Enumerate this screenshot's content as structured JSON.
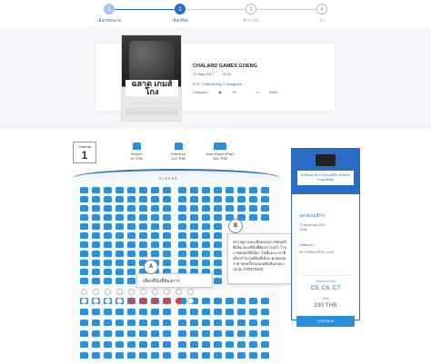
{
  "stepper": {
    "steps": [
      {
        "num": "1",
        "label": "เลือกรอบฉาย",
        "state": "done"
      },
      {
        "num": "2",
        "label": "เลือกที่นั่ง",
        "state": "active"
      },
      {
        "num": "3",
        "label": "ชำระเงิน",
        "state": "todo"
      },
      {
        "num": "4",
        "label": "ตั๋ว",
        "state": "todo"
      }
    ]
  },
  "movie": {
    "poster_title": "ฉลาด เกมส์โกง",
    "title": "CHALARD GAMES GOENG",
    "date": "17 May 2017",
    "time": "13:05",
    "location": "SF CINEMA Big C Bangplee",
    "cinema": "Cinema 1",
    "sound": "TH",
    "subtitle": "ENG"
  },
  "cinema_box": {
    "label": "Cinema",
    "number": "1"
  },
  "seat_types": [
    {
      "name": "Deluxe",
      "price": "90 THB"
    },
    {
      "name": "Premium",
      "price": "120 THB"
    },
    {
      "name": "Sofa Sweet (Pair)",
      "price": "350 THB"
    }
  ],
  "screen_label": "SCREEN",
  "callout_a": {
    "badge": "A",
    "text": "เลือกที่นั่งที่ต้องการ"
  },
  "callout_b": {
    "badge": "B",
    "text": "ตรวจดูรายละเอียดของภาพยนตร์ที่เลือกจองที่นั่งที่ต้องการแล้ว โรงภาพยนตร์ที่เลือก วันที่และเวลาที่เลือกจำนวนที่นั่งที่เลือก ตลอดจนราคาทุกครั้งก่อนกดยืนยันกรุณากดปุ่ม",
    "continue": "CONTINUE"
  },
  "summary": {
    "promo_label": "ทำบุ๊คและชำระเงินจองที่นั่ง พร้อมรับส่วนลดพิเศษ",
    "movie_title": "ฉลาดเกมส์โกง",
    "date": "17 พฤษภาคม 2017",
    "time": "13:05",
    "cinema": "Cinema 1",
    "address": "SF CINEMA บิ๊กซี บางพลี",
    "selected_label": "Selected Seat",
    "seats": "C5, C6, C7",
    "total_label": "Total",
    "total": "330 THB",
    "continue": "CONTINUE"
  },
  "colors": {
    "accent": "#2b6cc4",
    "seat": "#2b8fe0",
    "selected": "#e53b3b"
  }
}
